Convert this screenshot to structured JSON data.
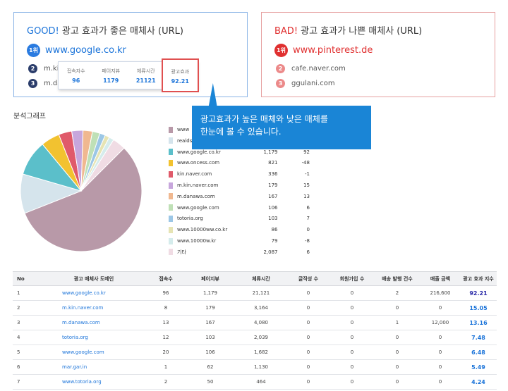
{
  "good_card": {
    "tag": "GOOD!",
    "title": " 광고 효과가 좋은 매체사 (URL)",
    "rank1_badge": "1위",
    "rank1_site": "www.google.co.kr",
    "rank2_badge": "2",
    "rank2_site": "m.kin.naver.com",
    "rank3_badge": "3",
    "rank3_site": "m.danawa.com"
  },
  "popup": {
    "metrics": [
      {
        "label": "접속자수",
        "value": "96"
      },
      {
        "label": "페이지뷰",
        "value": "1179"
      },
      {
        "label": "체류시간",
        "value": "21121"
      },
      {
        "label": "광고효과",
        "value": "92.21"
      }
    ]
  },
  "bad_card": {
    "tag": "BAD!",
    "title": " 광고 효과가 나쁜 매체사 (URL)",
    "rank1_badge": "1위",
    "rank1_site": "www.pinterest.de",
    "rank2_badge": "2",
    "rank2_site": "cafe.naver.com",
    "rank3_badge": "3",
    "rank3_site": "ggulani.com"
  },
  "callout": {
    "line1": "광고효과가 높은 매체와 낮은 매체를",
    "line2": "한눈에 볼 수 있습니다."
  },
  "chart_section": {
    "title": "분석그래프"
  },
  "chart_data": {
    "type": "pie",
    "legend": [
      {
        "name": "www",
        "value": "",
        "change": "",
        "color": "#b899a8"
      },
      {
        "name": "realds",
        "value": "",
        "change": "",
        "color": "#d5e4ec"
      },
      {
        "name": "www.google.co.kr",
        "value": "1,179",
        "change": "92",
        "color": "#5bbfca"
      },
      {
        "name": "www.oncess.com",
        "value": "821",
        "change": "-48",
        "color": "#f2c230"
      },
      {
        "name": "kin.naver.com",
        "value": "336",
        "change": "-1",
        "color": "#e05a6a"
      },
      {
        "name": "m.kin.naver.com",
        "value": "179",
        "change": "15",
        "color": "#c7a6dc"
      },
      {
        "name": "m.danawa.com",
        "value": "167",
        "change": "13",
        "color": "#f0b890"
      },
      {
        "name": "www.google.com",
        "value": "106",
        "change": "6",
        "color": "#bfe0b6"
      },
      {
        "name": "totoria.org",
        "value": "103",
        "change": "7",
        "color": "#9cc7e6"
      },
      {
        "name": "www.10000ww.co.kr",
        "value": "86",
        "change": "0",
        "color": "#e6e4b4"
      },
      {
        "name": "www.10000w.kr",
        "value": "79",
        "change": "-8",
        "color": "#d5ecec"
      },
      {
        "name": "기타",
        "value": "2,087",
        "change": "6",
        "color": "#f0dce4"
      }
    ],
    "slices": [
      {
        "label": "www",
        "share": 56.5,
        "color": "#b899a8"
      },
      {
        "label": "realds",
        "share": 10.5,
        "color": "#d5e4ec"
      },
      {
        "label": "www.google.co.kr",
        "share": 9.5,
        "color": "#5bbfca"
      },
      {
        "label": "www.oncess.com",
        "share": 5.0,
        "color": "#f2c230"
      },
      {
        "label": "kin.naver.com",
        "share": 3.5,
        "color": "#e05a6a"
      },
      {
        "label": "m.kin.naver.com",
        "share": 3.0,
        "color": "#c7a6dc"
      },
      {
        "label": "m.danawa.com",
        "share": 2.5,
        "color": "#f0b890"
      },
      {
        "label": "www.google.com",
        "share": 2.0,
        "color": "#bfe0b6"
      },
      {
        "label": "totoria.org",
        "share": 1.5,
        "color": "#9cc7e6"
      },
      {
        "label": "www.10000ww.co.kr",
        "share": 1.2,
        "color": "#e6e4b4"
      },
      {
        "label": "www.10000w.kr",
        "share": 1.3,
        "color": "#d5ecec"
      },
      {
        "label": "기타",
        "share": 3.5,
        "color": "#f0dce4"
      }
    ]
  },
  "table": {
    "headers": [
      "No",
      "광고 매체사 도메인",
      "접속수",
      "페이지뷰",
      "체류시간",
      "글작성 수",
      "회원가입 수",
      "배송 발행 건수",
      "매출 금액",
      "광고 효과 지수"
    ],
    "rows": [
      [
        "1",
        "www.google.co.kr",
        "96",
        "1,179",
        "21,121",
        "0",
        "0",
        "2",
        "216,600",
        "92.21"
      ],
      [
        "2",
        "m.kin.naver.com",
        "8",
        "179",
        "3,164",
        "0",
        "0",
        "0",
        "0",
        "15.05"
      ],
      [
        "3",
        "m.danawa.com",
        "13",
        "167",
        "4,080",
        "0",
        "0",
        "1",
        "12,000",
        "13.16"
      ],
      [
        "4",
        "totoria.org",
        "12",
        "103",
        "2,039",
        "0",
        "0",
        "0",
        "0",
        "7.48"
      ],
      [
        "5",
        "www.google.com",
        "20",
        "106",
        "1,682",
        "0",
        "0",
        "0",
        "0",
        "6.48"
      ],
      [
        "6",
        "mar.gar.in",
        "1",
        "62",
        "1,130",
        "0",
        "0",
        "0",
        "0",
        "5.49"
      ],
      [
        "7",
        "www.totoria.org",
        "2",
        "50",
        "464",
        "0",
        "0",
        "0",
        "0",
        "4.24"
      ]
    ]
  }
}
